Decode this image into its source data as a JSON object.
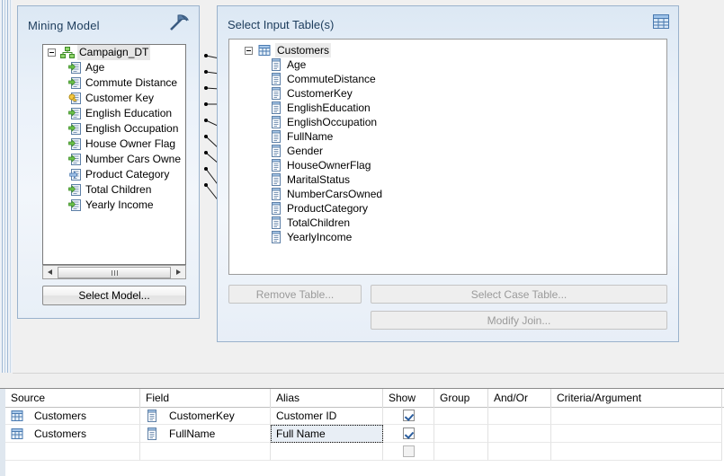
{
  "mining_panel": {
    "title": "Mining Model",
    "icon": "pickaxe-icon",
    "tree": {
      "root": {
        "label": "Campaign_DT",
        "icon": "mining-model-icon"
      },
      "columns": [
        {
          "label": "Age",
          "icon": "input-column-icon"
        },
        {
          "label": "Commute Distance",
          "icon": "input-column-icon"
        },
        {
          "label": "Customer Key",
          "icon": "key-column-icon"
        },
        {
          "label": "English Education",
          "icon": "input-column-icon"
        },
        {
          "label": "English Occupation",
          "icon": "input-column-icon"
        },
        {
          "label": "House Owner Flag",
          "icon": "input-column-icon"
        },
        {
          "label": "Number Cars Owne",
          "icon": "input-column-icon"
        },
        {
          "label": "Product Category",
          "icon": "predict-column-icon"
        },
        {
          "label": "Total Children",
          "icon": "input-column-icon"
        },
        {
          "label": "Yearly Income",
          "icon": "input-column-icon"
        }
      ]
    },
    "scrollbar": {
      "left_arrow": "left-arrow-icon",
      "right_arrow": "right-arrow-icon"
    },
    "select_model_label": "Select Model..."
  },
  "input_panel": {
    "title": "Select Input Table(s)",
    "icon": "table-icon",
    "tree": {
      "root": {
        "label": "Customers",
        "icon": "table-icon"
      },
      "columns": [
        "Age",
        "CommuteDistance",
        "CustomerKey",
        "EnglishEducation",
        "EnglishOccupation",
        "FullName",
        "Gender",
        "HouseOwnerFlag",
        "MaritalStatus",
        "NumberCarsOwned",
        "ProductCategory",
        "TotalChildren",
        "YearlyIncome"
      ]
    },
    "buttons": {
      "remove_table": "Remove Table...",
      "select_case_table": "Select Case Table...",
      "modify_join": "Modify Join..."
    }
  },
  "grid": {
    "headers": [
      "Source",
      "Field",
      "Alias",
      "Show",
      "Group",
      "And/Or",
      "Criteria/Argument"
    ],
    "rows": [
      {
        "source": "Customers",
        "field": "CustomerKey",
        "alias": "Customer ID",
        "show": true,
        "group": "",
        "and_or": "",
        "criteria": "",
        "focused": false
      },
      {
        "source": "Customers",
        "field": "FullName",
        "alias": "Full Name",
        "show": true,
        "group": "",
        "and_or": "",
        "criteria": "",
        "focused": true
      },
      {
        "source": "",
        "field": "",
        "alias": "",
        "show": false,
        "group": "",
        "and_or": "",
        "criteria": "",
        "focused": false
      }
    ]
  },
  "colors": {
    "panel_border": "#9ab2cc",
    "title_text": "#1c3c5c",
    "checkbox_check": "#2a5d9e",
    "canvas_bg": "#f0f0f0"
  }
}
